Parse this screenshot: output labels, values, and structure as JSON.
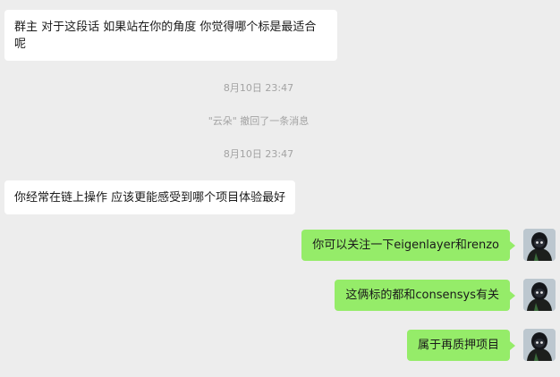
{
  "messages": {
    "m1": "群主 对于这段话 如果站在你的角度 你觉得哪个标是最适合呢",
    "ts1": "8月10日 23:47",
    "recall": "\"云朵\" 撤回了一条消息",
    "ts2": "8月10日 23:47",
    "m2": "你经常在链上操作 应该更能感受到哪个项目体验最好",
    "m3": "你可以关注一下eigenlayer和renzo",
    "m4": "这俩标的都和consensys有关",
    "m5": "属于再质押项目"
  },
  "colors": {
    "background": "#ededed",
    "incoming_bubble": "#ffffff",
    "outgoing_bubble": "#95ec69",
    "system_text": "#a3a3a3"
  },
  "icons": {
    "avatar": "hooded-figure-avatar"
  }
}
